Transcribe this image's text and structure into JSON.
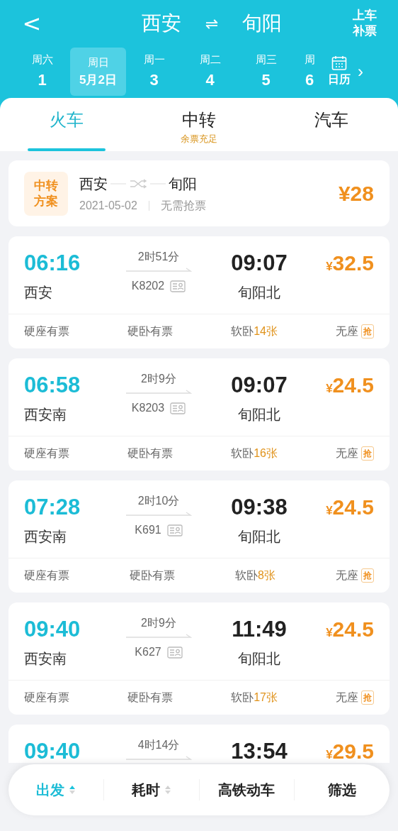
{
  "header": {
    "back": "<",
    "from": "西安",
    "swap": "⇌",
    "to": "旬阳",
    "action": [
      "上车",
      "补票"
    ]
  },
  "dates": [
    {
      "week": "周六",
      "day": "1",
      "selected": false
    },
    {
      "week": "周日",
      "day": "5月2日",
      "selected": true
    },
    {
      "week": "周一",
      "day": "3",
      "selected": false
    },
    {
      "week": "周二",
      "day": "4",
      "selected": false
    },
    {
      "week": "周三",
      "day": "5",
      "selected": false
    },
    {
      "week": "周",
      "day": "6",
      "selected": false
    }
  ],
  "calendar": {
    "label": "日历",
    "arrow": "›"
  },
  "tabs": [
    {
      "label": "火车",
      "selected": true
    },
    {
      "label": "中转",
      "selected": false,
      "note": "余票充足"
    },
    {
      "label": "汽车",
      "selected": false
    }
  ],
  "transfer": {
    "badge": [
      "中转",
      "方案"
    ],
    "from": "西安",
    "to": "旬阳",
    "date": "2021-05-02",
    "note": "无需抢票",
    "price": "¥28"
  },
  "trains": [
    {
      "depart": "06:16",
      "duration": "2时51分",
      "arrive": "09:07",
      "currency": "¥",
      "price": "32.5",
      "from": "西安",
      "number": "K8202",
      "to": "旬阳北",
      "seats": [
        {
          "kind": "text",
          "label": "硬座有票"
        },
        {
          "kind": "text",
          "label": "硬卧有票"
        },
        {
          "kind": "count",
          "label": "软卧",
          "count": "14张"
        },
        {
          "kind": "grab",
          "label": "无座",
          "badge": "抢"
        }
      ]
    },
    {
      "depart": "06:58",
      "duration": "2时9分",
      "arrive": "09:07",
      "currency": "¥",
      "price": "24.5",
      "from": "西安南",
      "number": "K8203",
      "to": "旬阳北",
      "seats": [
        {
          "kind": "text",
          "label": "硬座有票"
        },
        {
          "kind": "text",
          "label": "硬卧有票"
        },
        {
          "kind": "count",
          "label": "软卧",
          "count": "16张"
        },
        {
          "kind": "grab",
          "label": "无座",
          "badge": "抢"
        }
      ]
    },
    {
      "depart": "07:28",
      "duration": "2时10分",
      "arrive": "09:38",
      "currency": "¥",
      "price": "24.5",
      "from": "西安南",
      "number": "K691",
      "to": "旬阳北",
      "seats": [
        {
          "kind": "text",
          "label": "硬座有票"
        },
        {
          "kind": "text",
          "label": "硬卧有票"
        },
        {
          "kind": "count",
          "label": "软卧",
          "count": "8张"
        },
        {
          "kind": "grab",
          "label": "无座",
          "badge": "抢"
        }
      ]
    },
    {
      "depart": "09:40",
      "duration": "2时9分",
      "arrive": "11:49",
      "currency": "¥",
      "price": "24.5",
      "from": "西安南",
      "number": "K627",
      "to": "旬阳北",
      "seats": [
        {
          "kind": "text",
          "label": "硬座有票"
        },
        {
          "kind": "text",
          "label": "硬卧有票"
        },
        {
          "kind": "count",
          "label": "软卧",
          "count": "17张"
        },
        {
          "kind": "grab",
          "label": "无座",
          "badge": "抢"
        }
      ]
    },
    {
      "depart": "09:40",
      "duration": "4时14分",
      "arrive": "13:54",
      "currency": "¥",
      "price": "29.5"
    }
  ],
  "sort_bar": [
    {
      "label": "出发",
      "selected": true,
      "sortable": true
    },
    {
      "label": "耗时",
      "selected": false,
      "sortable": true
    },
    {
      "label": "高铁动车",
      "selected": false,
      "sortable": false
    },
    {
      "label": "筛选",
      "selected": false,
      "sortable": false
    }
  ]
}
